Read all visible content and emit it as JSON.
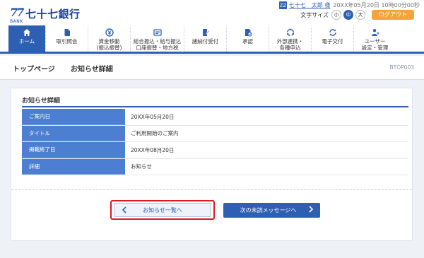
{
  "header": {
    "logo_mark": "77",
    "logo_bank": "BANK",
    "logo_text": "七十七銀行",
    "user_icon": "ZZ",
    "user_name": "七十七　太郎 様",
    "login_time": "20XX年05月20日 10時00分00秒",
    "font_size_label": "文字サイズ",
    "font_sizes": [
      "小",
      "中",
      "大"
    ],
    "logout": "ログアウト"
  },
  "nav": [
    {
      "label": "ホーム",
      "icon": "home-icon"
    },
    {
      "label": "取引照会",
      "icon": "document-icon"
    },
    {
      "label": "資金移動\n(振込振替)",
      "icon": "yen-transfer-icon"
    },
    {
      "label": "総合振込・給与振込\n口座振替・地方税",
      "icon": "card-icon"
    },
    {
      "label": "諸納付受付",
      "icon": "edit-document-icon"
    },
    {
      "label": "承認",
      "icon": "approval-icon"
    },
    {
      "label": "外部連携・\n各種申込",
      "icon": "link-icon"
    },
    {
      "label": "電子交付",
      "icon": "sync-icon"
    },
    {
      "label": "ユーザー\n設定・管理",
      "icon": "user-settings-icon"
    }
  ],
  "breadcrumb": {
    "top": "トップページ",
    "current": "お知らせ詳細",
    "screen_id": "BTOP003"
  },
  "panel": {
    "title": "お知らせ詳細",
    "rows": [
      {
        "label": "ご案内日",
        "value": "20XX年05月20日"
      },
      {
        "label": "タイトル",
        "value": "ご利用開始のご案内"
      },
      {
        "label": "掲載終了日",
        "value": "20XX年08月20日"
      },
      {
        "label": "詳細",
        "value": "お知らせ"
      }
    ],
    "back_button": "お知らせ一覧へ",
    "next_button": "次の未読メッセージへ"
  },
  "colors": {
    "brand": "#2d5fb3",
    "header_cell": "#4c7fd1",
    "logout": "#f4a43a",
    "highlight": "#e0191f"
  }
}
